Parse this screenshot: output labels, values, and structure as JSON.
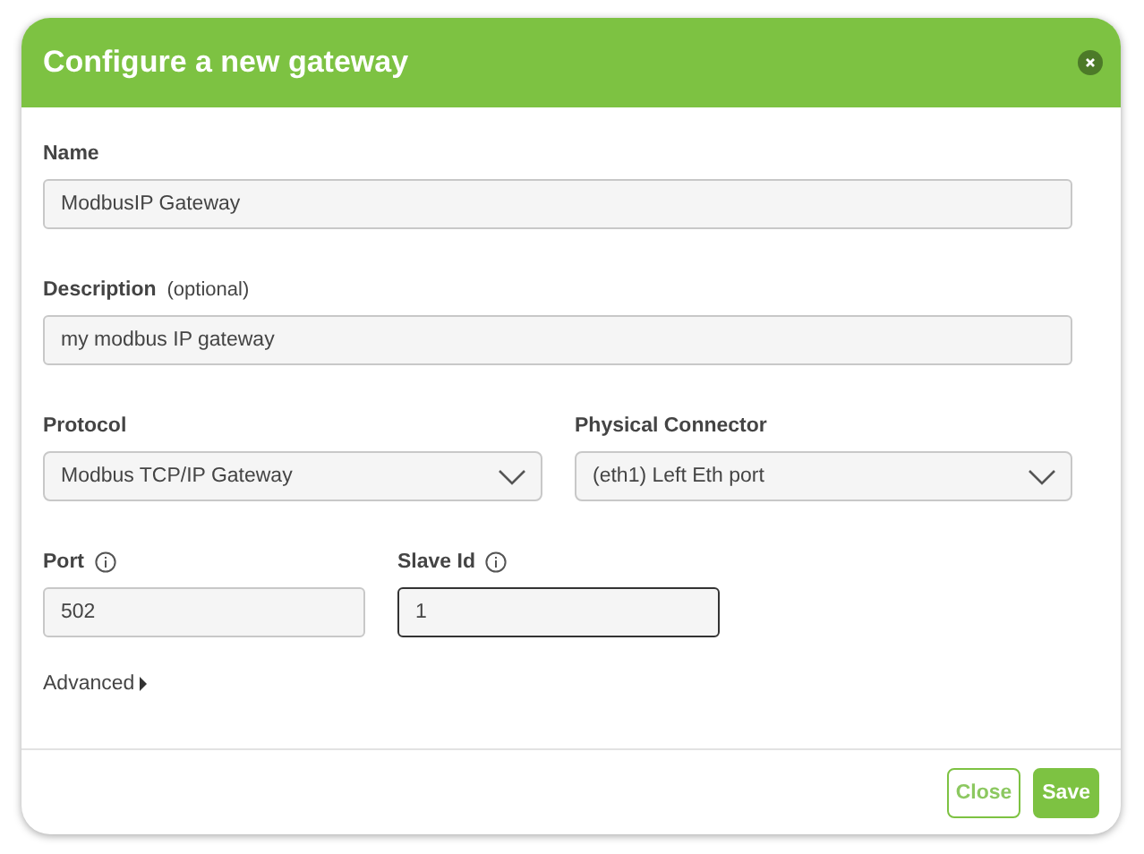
{
  "dialog": {
    "title": "Configure a new gateway"
  },
  "name": {
    "label": "Name",
    "value": "ModbusIP Gateway",
    "focused": false
  },
  "description": {
    "label": "Description",
    "hint": "(optional)",
    "value": "my modbus IP gateway",
    "focused": false
  },
  "protocol": {
    "label": "Protocol",
    "value": "Modbus TCP/IP Gateway"
  },
  "connector": {
    "label": "Physical Connector",
    "value": "(eth1) Left Eth port"
  },
  "port": {
    "label": "Port",
    "value": "502",
    "focused": false
  },
  "slave_id": {
    "label": "Slave Id",
    "value": "1",
    "focused": true
  },
  "advanced": {
    "label": "Advanced",
    "expanded": false
  },
  "buttons": [
    {
      "label": "Close",
      "kind": "secondary"
    },
    {
      "label": "Save",
      "kind": "primary"
    }
  ]
}
